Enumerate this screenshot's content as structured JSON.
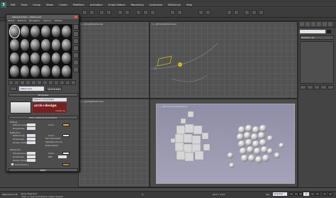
{
  "app": {
    "icon": "3ds-max-app-icon"
  },
  "menubar": [
    "Edit",
    "Tools",
    "Group",
    "Views",
    "Create",
    "Modifiers",
    "Animation",
    "Graph Editors",
    "Rendering",
    "Customize",
    "MAXScript",
    "Help"
  ],
  "viewports": {
    "top": "[ + ][Top][Wireframe]",
    "front": "[ + ][Front][Wireframe]",
    "left": "[ + ][Left][Wireframe]",
    "perspective": "[ + ][Perspective][Realistic]"
  },
  "command_panel": {
    "modifier_list": "Modifier List"
  },
  "material_editor": {
    "title": "Material Editor - Metal Gold",
    "menu": [
      "Modes",
      "Material",
      "Navigation",
      "Options",
      "Utilities"
    ],
    "material_name": "Metal Gold",
    "material_type": "Arch & Design",
    "rollout_templates": "Templates",
    "template_select": "(Select a template)",
    "logo_text": "arch+design",
    "logo_sub": "mental ray",
    "rollout_main": "Main material parameters",
    "params": {
      "diffuse": "Diffuse",
      "diffuse_level": "Diffuse Level:",
      "roughness": "Roughness:",
      "reflection": "Reflection",
      "reflectivity": "Reflectivity:",
      "glossiness": "Glossiness:",
      "glossy_samples": "Glossy Samples:",
      "refraction": "Refraction",
      "transparency": "Transparency:",
      "translucency": "Translucency",
      "color": "Color:",
      "ior": "IOR:",
      "fast_interpolate": "Fast (interpolate)",
      "highlights_fg": "Highlights+FG only",
      "metal_material": "Metal material"
    },
    "rollout_brdf": "BRDF"
  },
  "statusbar": {
    "welcome": "Welcome to M",
    "selection": "None Selected",
    "hint": "Click or click-and-drag to select objects",
    "x_label": "X:",
    "grid": "Grid = 10.0",
    "key_label": "Key",
    "key_select": "Selected",
    "frame": "0"
  },
  "colors": {
    "diffuse_swatch": "#f0b04a",
    "accent_red": "#7a1f1f",
    "render_bg": "#9a99b0"
  }
}
